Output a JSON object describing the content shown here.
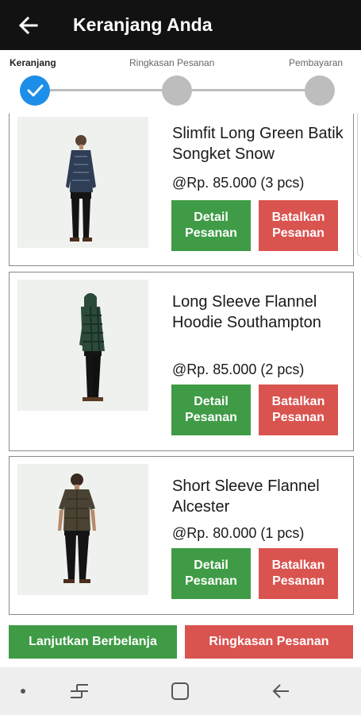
{
  "header": {
    "title": "Keranjang Anda",
    "back_icon": "arrow-left-icon"
  },
  "stepper": {
    "steps": [
      {
        "label": "Keranjang",
        "state": "done"
      },
      {
        "label": "Ringkasan Pesanan",
        "state": "pending"
      },
      {
        "label": "Pembayaran",
        "state": "pending"
      }
    ],
    "active_color": "#1e8fe8",
    "inactive_color": "#bdbdbd"
  },
  "cart": {
    "items": [
      {
        "name": "Slimfit Long Green Batik Songket Snow",
        "price": "@Rp. 85.000 (3 pcs)",
        "detail_label": [
          "Detail",
          "Pesanan"
        ],
        "cancel_label": [
          "Batalkan",
          "Pesanan"
        ]
      },
      {
        "name": "Long Sleeve Flannel Hoodie Southampton",
        "price": "@Rp. 85.000 (2 pcs)",
        "detail_label": [
          "Detail",
          "Pesanan"
        ],
        "cancel_label": [
          "Batalkan",
          "Pesanan"
        ]
      },
      {
        "name": "Short Sleeve Flannel Alcester",
        "price": "@Rp. 80.000 (1 pcs)",
        "detail_label": [
          "Detail",
          "Pesanan"
        ],
        "cancel_label": [
          "Batalkan",
          "Pesanan"
        ]
      }
    ]
  },
  "footer": {
    "continue_label": "Lanjutkan Berbelanja",
    "summary_label": "Ringkasan Pesanan"
  },
  "colors": {
    "header_bg": "#121212",
    "green": "#3f9b46",
    "red": "#d9534f"
  },
  "system_nav": {
    "icons": [
      "dot-icon",
      "recent-apps-icon",
      "home-icon",
      "back-icon"
    ]
  }
}
